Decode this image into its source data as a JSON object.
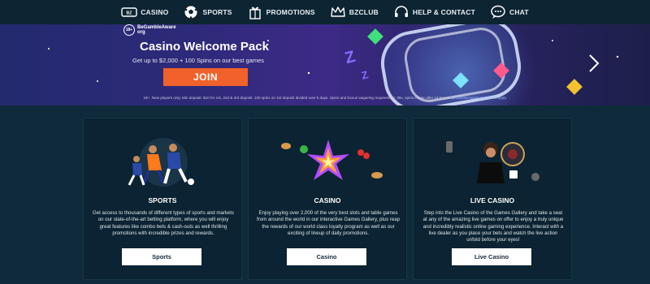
{
  "nav": {
    "items": [
      {
        "label": "CASINO",
        "icon": "casino-logo-icon"
      },
      {
        "label": "SPORTS",
        "icon": "soccer-ball-icon"
      },
      {
        "label": "PROMOTIONS",
        "icon": "gift-icon"
      },
      {
        "label": "BZCLUB",
        "icon": "crown-icon"
      },
      {
        "label": "HELP & CONTACT",
        "icon": "headset-icon"
      },
      {
        "label": "CHAT",
        "icon": "chat-bubble-icon"
      }
    ]
  },
  "hero": {
    "badge_age": "18+",
    "badge_text_1": "BeGambleAware",
    "badge_text_2": "org",
    "title": "Casino Welcome Pack",
    "subtitle": "Get up to $2,000 + 100 Spins on our best games",
    "join_label": "JOIN",
    "terms": "18+. New players only. Min deposit: $10 for 1st, 2nd & 3rd deposit. 100 spins on 1st deposit divided over 5 days. Spins and bonus wagering requirement: 35x, spins expire after 24 hours.",
    "terms_link_1": "BeGambleAware.org",
    "terms_link_2": "Terms apply"
  },
  "cards": [
    {
      "title": "SPORTS",
      "description": "Get access to thousands of different types of sports and markets on our state-of-the-art betting platform, where you will enjoy great features like combo bets & cash-outs as well thrilling promotions with incredible prizes and rewards.",
      "button": "Sports"
    },
    {
      "title": "CASINO",
      "description": "Enjoy playing over 2,000 of the very best slots and table games from around the world in our interactive Games Gallery, plus reap the rewards of our world class loyalty program as well as our exciting of lineup of daily promotions.",
      "button": "Casino"
    },
    {
      "title": "LIVE CASINO",
      "description": "Step into the Live Casino of the Games Gallery and take a seat at any of the amazing live games on offer to enjoy a truly unique and incredibly realistic online gaming experience. Interact with a live dealer as you place your bets and watch the live action unfold before your eyes!",
      "button": "Live Casino"
    }
  ],
  "colors": {
    "background": "#0f2a3a",
    "card": "#0b2332",
    "join": "#f0612b"
  }
}
